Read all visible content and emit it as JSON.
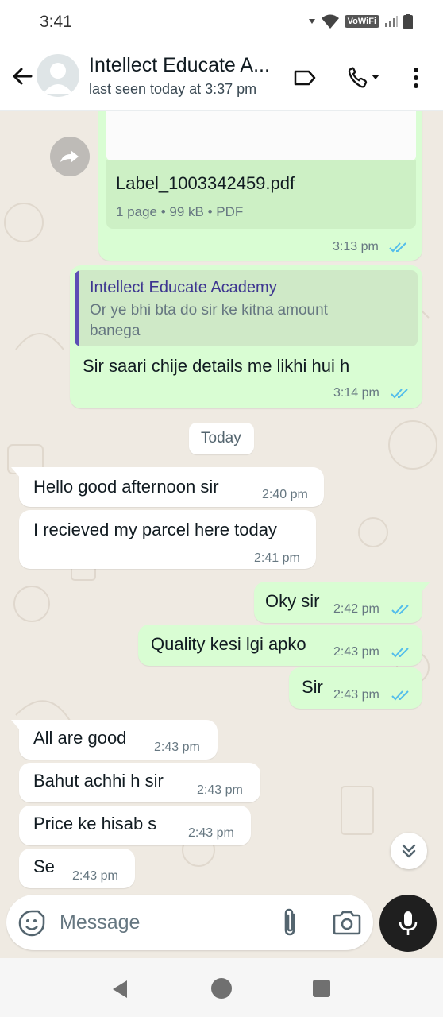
{
  "status_bar": {
    "time": "3:41",
    "vowifi": "VoWiFi"
  },
  "header": {
    "contact_name": "Intellect Educate A...",
    "last_seen": "last seen today at 3:37 pm"
  },
  "messages": {
    "pdf": {
      "filename": "Label_1003342459.pdf",
      "meta": "1 page • 99 kB • PDF",
      "time": "3:13 pm"
    },
    "reply": {
      "quoted_sender": "Intellect Educate Academy",
      "quoted_line1": "Or ye bhi bta do sir ke kitna amount",
      "quoted_line2": "banega",
      "text": "Sir saari chije details me likhi hui h",
      "time": "3:14 pm"
    },
    "date_divider": "Today",
    "m1": {
      "text": "Hello good afternoon sir",
      "time": "2:40 pm"
    },
    "m2": {
      "text": "I recieved my parcel here today",
      "time": "2:41 pm"
    },
    "m3": {
      "text": "Oky sir",
      "time": "2:42 pm"
    },
    "m4": {
      "text": "Quality kesi lgi apko",
      "time": "2:43 pm"
    },
    "m5": {
      "text": "Sir",
      "time": "2:43 pm"
    },
    "m6": {
      "text": "All are good",
      "time": "2:43 pm"
    },
    "m7": {
      "text": "Bahut achhi h sir",
      "time": "2:43 pm"
    },
    "m8": {
      "text": "Price ke hisab s",
      "time": "2:43 pm"
    },
    "m9": {
      "text": "Se",
      "time": "2:43 pm"
    }
  },
  "input": {
    "placeholder": "Message"
  },
  "colors": {
    "outgoing_bubble": "#d9fdd3",
    "incoming_bubble": "#ffffff",
    "chat_background": "#efeae2",
    "read_ticks": "#53bdeb",
    "quote_accent": "#5c4fb5"
  },
  "icons": [
    "back-arrow-icon",
    "avatar-icon",
    "label-icon",
    "phone-icon",
    "more-options-icon",
    "forward-icon",
    "read-ticks-icon",
    "scroll-down-icon",
    "emoji-icon",
    "attach-icon",
    "camera-icon",
    "mic-icon",
    "nav-back-icon",
    "nav-home-icon",
    "nav-recents-icon"
  ]
}
